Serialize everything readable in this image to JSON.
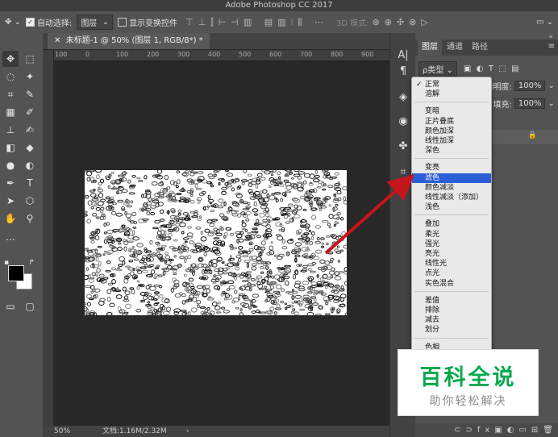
{
  "window": {
    "title": "Adobe Photoshop CC 2017"
  },
  "options_bar": {
    "auto_select_label": "自动选择:",
    "auto_select_checked": true,
    "auto_select_target": "图层",
    "show_transform_label": "显示变换控件",
    "show_transform_checked": false,
    "mode_3d_label": "3D 模式:"
  },
  "document": {
    "tab_title": "未标题-1 @ 50% (图层 1, RGB/8*) *",
    "ruler_ticks": [
      "100",
      "0",
      "100",
      "200",
      "300",
      "400",
      "500",
      "600",
      "700",
      "800",
      "900"
    ]
  },
  "status_bar": {
    "zoom": "50%",
    "doc_info": "文档:1.16M/2.32M"
  },
  "layers_panel": {
    "tabs": [
      "图层",
      "通道",
      "路径"
    ],
    "active_tab": "图层",
    "filter_label": "ρ类型",
    "opacity_label": "不透明度:",
    "opacity_value": "100%",
    "fill_label": "填充:",
    "fill_value": "100%"
  },
  "blend_menu": {
    "items": [
      "正常",
      "溶解",
      "变暗",
      "正片叠底",
      "颜色加深",
      "线性加深",
      "深色",
      "变亮",
      "滤色",
      "颜色减淡",
      "线性减淡（添加）",
      "浅色",
      "叠加",
      "柔光",
      "强光",
      "亮光",
      "线性光",
      "点光",
      "实色混合",
      "差值",
      "排除",
      "减去",
      "划分",
      "色相"
    ],
    "checked": "正常",
    "highlighted": "滤色"
  },
  "watermark": {
    "title": "百科全说",
    "subtitle": "助你轻松解决"
  },
  "colors": {
    "accent_highlight": "#2a5fd8",
    "arrow": "#c4161c",
    "watermark_green": "#0aa84f"
  }
}
